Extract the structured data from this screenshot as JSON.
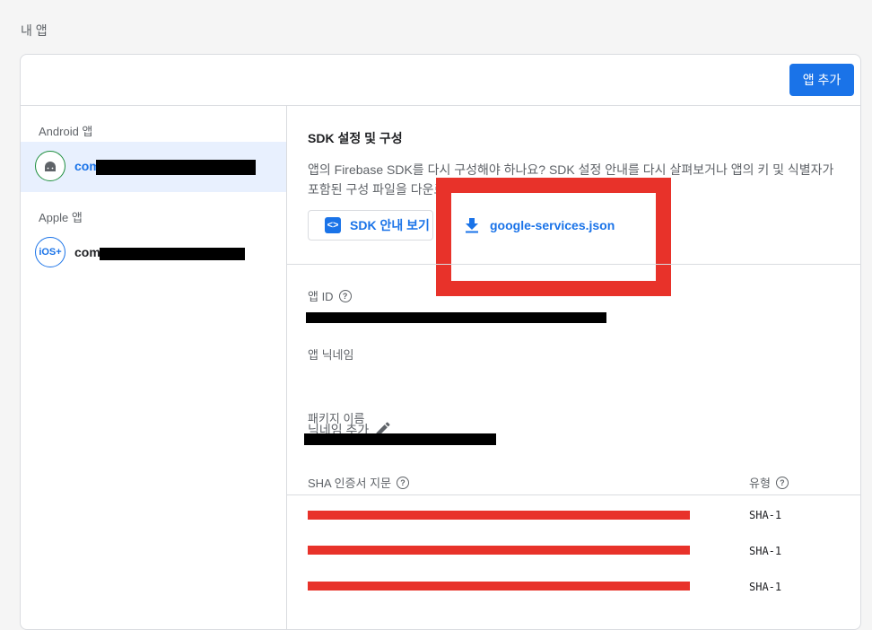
{
  "page": {
    "title": "내 앱"
  },
  "header": {
    "add_app_label": "앱 추가"
  },
  "sidebar": {
    "android_group_label": "Android 앱",
    "apple_group_label": "Apple 앱",
    "android_app": {
      "name_prefix": "com"
    },
    "ios_app": {
      "name_prefix": "com",
      "icon_text": "iOS+"
    }
  },
  "sdk": {
    "title": "SDK 설정 및 구성",
    "description": "앱의 Firebase SDK를 다시 구성해야 하나요? SDK 설정 안내를 다시 살펴보거나 앱의 키 및 식별자가 포함된 구성 파일을 다운로드하세",
    "view_sdk_label": "SDK 안내 보기",
    "download_label": "google-services.json"
  },
  "fields": {
    "app_id_label": "앱 ID",
    "nickname_label": "앱 닉네임",
    "nickname_value": "닉네임 추가",
    "package_label": "패키지 이름",
    "sha_label": "SHA 인증서 지문",
    "type_label": "유형"
  },
  "sha_rows": [
    {
      "type": "SHA-1"
    },
    {
      "type": "SHA-1"
    },
    {
      "type": "SHA-1"
    }
  ],
  "colors": {
    "accent": "#1a73e8",
    "highlight": "#e8322a",
    "android": "#1e8e3e"
  }
}
